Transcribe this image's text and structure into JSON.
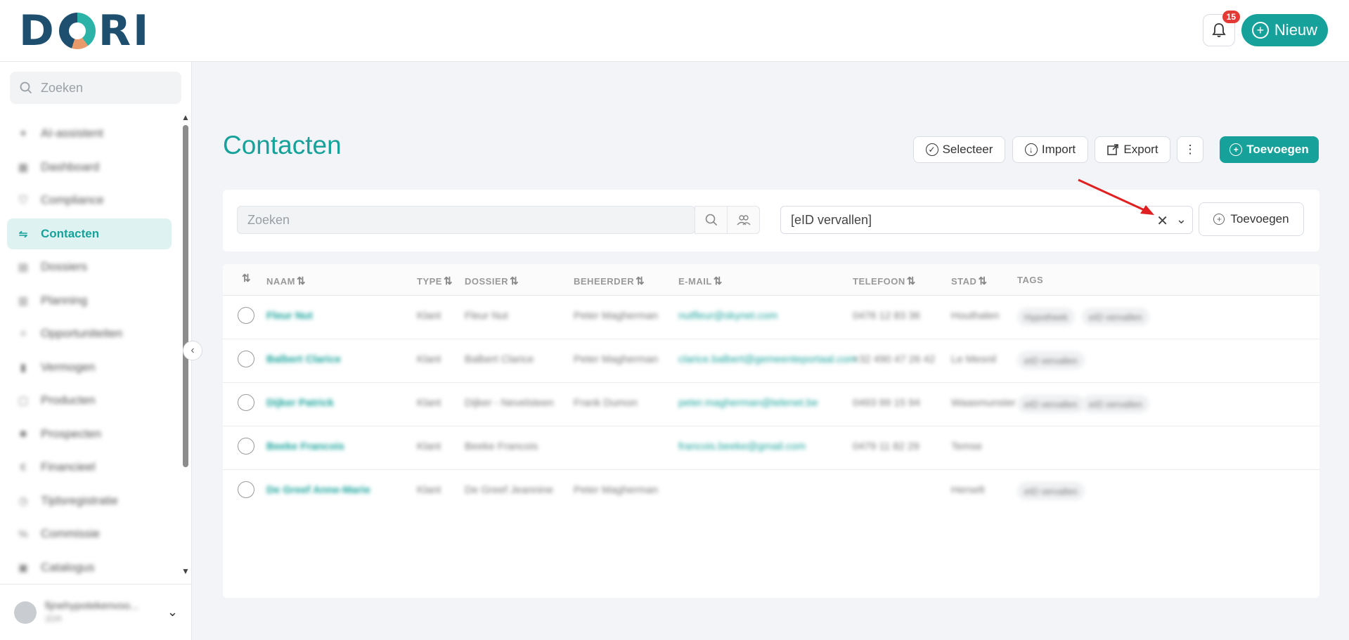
{
  "header": {
    "logo": "DORI",
    "notification_count": "15",
    "new_button": "Nieuw"
  },
  "sidebar": {
    "search_placeholder": "Zoeken",
    "items": [
      {
        "label": "AI-assistent",
        "icon": "sparkle-icon"
      },
      {
        "label": "Dashboard",
        "icon": "grid-icon"
      },
      {
        "label": "Compliance",
        "icon": "shield-icon"
      },
      {
        "label": "Contacten",
        "icon": "handshake-icon",
        "active": true
      },
      {
        "label": "Dossiers",
        "icon": "folder-icon"
      },
      {
        "label": "Planning",
        "icon": "calendar-icon"
      },
      {
        "label": "Opportuniteiten",
        "icon": "lightbulb-icon"
      },
      {
        "label": "Vermogen",
        "icon": "bar-chart-icon"
      },
      {
        "label": "Producten",
        "icon": "box-icon"
      },
      {
        "label": "Prospecten",
        "icon": "users-icon"
      },
      {
        "label": "Financieel",
        "icon": "euro-icon"
      },
      {
        "label": "Tijdsregistratie",
        "icon": "clock-icon"
      },
      {
        "label": "Commissie",
        "icon": "percent-icon"
      },
      {
        "label": "Catalogus",
        "icon": "book-icon"
      }
    ],
    "user": {
      "name": "fijnehypotekenvoo...",
      "role": "2DR"
    }
  },
  "page": {
    "title": "Contacten",
    "toolbar": {
      "select": "Selecteer",
      "import": "Import",
      "export": "Export",
      "more": "⋮",
      "add": "Toevoegen"
    },
    "filter": {
      "search_placeholder": "Zoeken",
      "active_filter": "[eID vervallen]",
      "add_filter": "Toevoegen"
    },
    "table": {
      "columns": [
        "NAAM",
        "TYPE",
        "DOSSIER",
        "BEHEERDER",
        "E-MAIL",
        "TELEFOON",
        "STAD",
        "TAGS"
      ],
      "rows": [
        {
          "naam": "Fleur Nut",
          "type": "Klant",
          "dossier": "Fleur Nut",
          "beheerder": "Peter Magherman",
          "email": "nutfleur@skynet.com",
          "telefoon": "0476 12 83 36",
          "stad": "Houthalen",
          "tags": [
            "Hypotheek",
            "eID vervallen"
          ]
        },
        {
          "naam": "Balbert Clarice",
          "type": "Klant",
          "dossier": "Balbert Clarice",
          "beheerder": "Peter Magherman",
          "email": "clarice.balbert@gemeenteportaal.com",
          "telefoon": "+32 490 47 26 42",
          "stad": "Le Mesnil",
          "tags": [
            "eID vervallen"
          ]
        },
        {
          "naam": "Dijker Patrick",
          "type": "Klant",
          "dossier": "Dijker - Nevelsteen",
          "beheerder": "Frank Dumon",
          "email": "peter.magherman@telenet.be",
          "telefoon": "0493 99 15 94",
          "stad": "Waasmunster",
          "tags": [
            "eID vervallen",
            "eID vervallen"
          ]
        },
        {
          "naam": "Beeke Francois",
          "type": "Klant",
          "dossier": "Beeke Francois",
          "beheerder": "",
          "email": "francois.beeke@gmail.com",
          "telefoon": "0479 11 82 29",
          "stad": "Temse",
          "tags": []
        },
        {
          "naam": "De Greef Anne-Marie",
          "type": "Klant",
          "dossier": "De Greef Jeannine",
          "beheerder": "Peter Magherman",
          "email": "",
          "telefoon": "",
          "stad": "Herselt",
          "tags": [
            "eID vervallen"
          ]
        }
      ]
    }
  }
}
